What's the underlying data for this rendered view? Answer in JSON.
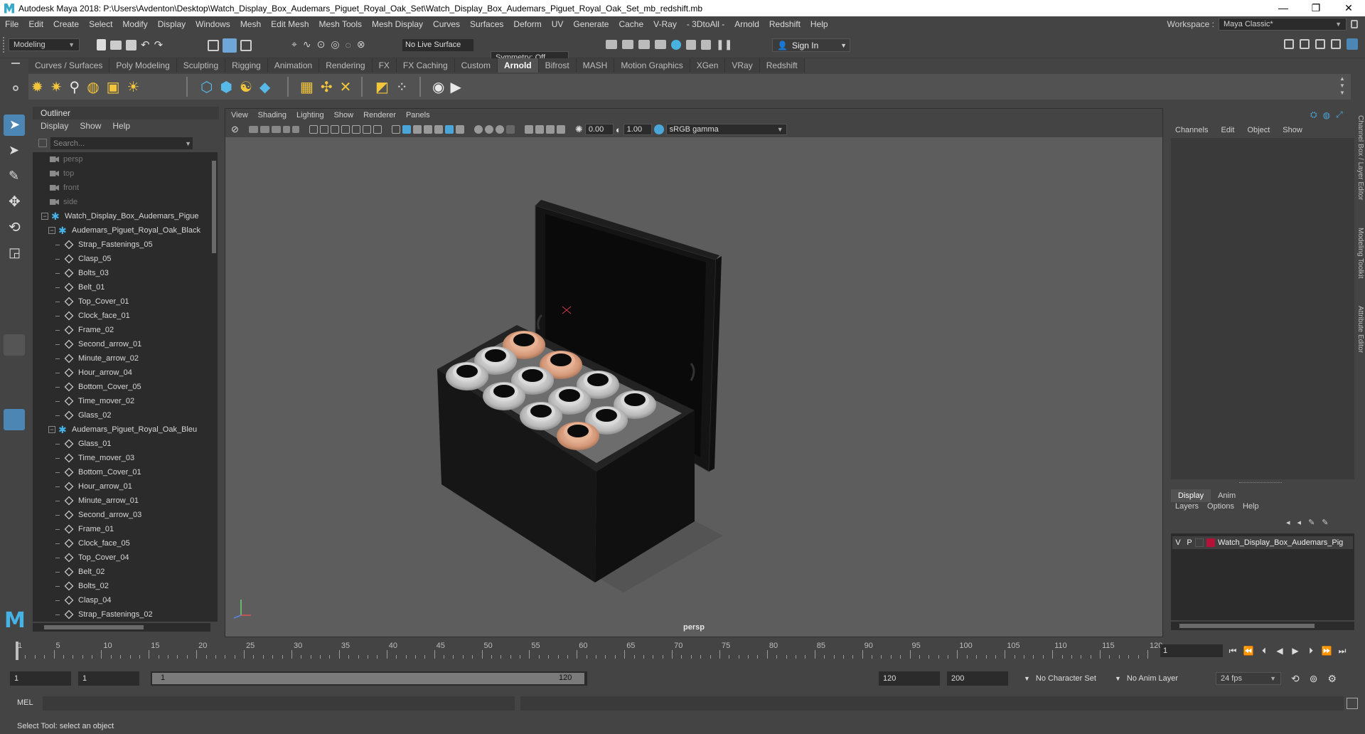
{
  "title_bar": {
    "text": "Autodesk Maya 2018: P:\\Users\\Avdenton\\Desktop\\Watch_Display_Box_Audemars_Piguet_Royal_Oak_Set\\Watch_Display_Box_Audemars_Piguet_Royal_Oak_Set_mb_redshift.mb",
    "minimize": "—",
    "maximize": "❐",
    "close": "✕"
  },
  "menubar": {
    "items": [
      "File",
      "Edit",
      "Create",
      "Select",
      "Modify",
      "Display",
      "Windows",
      "Mesh",
      "Edit Mesh",
      "Mesh Tools",
      "Mesh Display",
      "Curves",
      "Surfaces",
      "Deform",
      "UV",
      "Generate",
      "Cache",
      "V-Ray",
      "- 3DtoAll -",
      "Arnold",
      "Redshift",
      "Help"
    ],
    "workspace_label": "Workspace :",
    "workspace_value": "Maya Classic*"
  },
  "statusline": {
    "mode": "Modeling",
    "live_surface": "No Live Surface",
    "symmetry": "Symmetry: Off",
    "sign_in": "Sign In"
  },
  "shelf": {
    "tabs": [
      "Curves / Surfaces",
      "Poly Modeling",
      "Sculpting",
      "Rigging",
      "Animation",
      "Rendering",
      "FX",
      "FX Caching",
      "Custom",
      "Arnold",
      "Bifrost",
      "MASH",
      "Motion Graphics",
      "XGen",
      "VRay",
      "Redshift"
    ],
    "active_tab": "Arnold"
  },
  "outliner": {
    "title": "Outliner",
    "menu": [
      "Display",
      "Show",
      "Help"
    ],
    "search_placeholder": "Search...",
    "items": [
      {
        "label": "persp",
        "type": "camera",
        "indent": 0
      },
      {
        "label": "top",
        "type": "camera",
        "indent": 0
      },
      {
        "label": "front",
        "type": "camera",
        "indent": 0
      },
      {
        "label": "side",
        "type": "camera",
        "indent": 0
      },
      {
        "label": "Watch_Display_Box_Audemars_Pigue",
        "type": "group",
        "indent": 0,
        "expanded": true
      },
      {
        "label": "Audemars_Piguet_Royal_Oak_Black",
        "type": "group",
        "indent": 1,
        "expanded": true
      },
      {
        "label": "Strap_Fastenings_05",
        "type": "mesh",
        "indent": 2
      },
      {
        "label": "Clasp_05",
        "type": "mesh",
        "indent": 2
      },
      {
        "label": "Bolts_03",
        "type": "mesh",
        "indent": 2
      },
      {
        "label": "Belt_01",
        "type": "mesh",
        "indent": 2
      },
      {
        "label": "Top_Cover_01",
        "type": "mesh",
        "indent": 2
      },
      {
        "label": "Clock_face_01",
        "type": "mesh",
        "indent": 2
      },
      {
        "label": "Frame_02",
        "type": "mesh",
        "indent": 2
      },
      {
        "label": "Second_arrow_01",
        "type": "mesh",
        "indent": 2
      },
      {
        "label": "Minute_arrow_02",
        "type": "mesh",
        "indent": 2
      },
      {
        "label": "Hour_arrow_04",
        "type": "mesh",
        "indent": 2
      },
      {
        "label": "Bottom_Cover_05",
        "type": "mesh",
        "indent": 2
      },
      {
        "label": "Time_mover_02",
        "type": "mesh",
        "indent": 2
      },
      {
        "label": "Glass_02",
        "type": "mesh",
        "indent": 2
      },
      {
        "label": "Audemars_Piguet_Royal_Oak_Bleu",
        "type": "group",
        "indent": 1,
        "expanded": true
      },
      {
        "label": "Glass_01",
        "type": "mesh",
        "indent": 2
      },
      {
        "label": "Time_mover_03",
        "type": "mesh",
        "indent": 2
      },
      {
        "label": "Bottom_Cover_01",
        "type": "mesh",
        "indent": 2
      },
      {
        "label": "Hour_arrow_01",
        "type": "mesh",
        "indent": 2
      },
      {
        "label": "Minute_arrow_01",
        "type": "mesh",
        "indent": 2
      },
      {
        "label": "Second_arrow_03",
        "type": "mesh",
        "indent": 2
      },
      {
        "label": "Frame_01",
        "type": "mesh",
        "indent": 2
      },
      {
        "label": "Clock_face_05",
        "type": "mesh",
        "indent": 2
      },
      {
        "label": "Top_Cover_04",
        "type": "mesh",
        "indent": 2
      },
      {
        "label": "Belt_02",
        "type": "mesh",
        "indent": 2
      },
      {
        "label": "Bolts_02",
        "type": "mesh",
        "indent": 2
      },
      {
        "label": "Clasp_04",
        "type": "mesh",
        "indent": 2
      },
      {
        "label": "Strap_Fastenings_02",
        "type": "mesh",
        "indent": 2
      }
    ]
  },
  "viewport": {
    "menu": [
      "View",
      "Shading",
      "Lighting",
      "Show",
      "Renderer",
      "Panels"
    ],
    "exposure": "0.00",
    "gamma": "1.00",
    "color_space": "sRGB gamma",
    "camera_label": "persp"
  },
  "channel_box": {
    "menu": [
      "Channels",
      "Edit",
      "Object",
      "Show"
    ],
    "layer_tabs": [
      "Display",
      "Anim"
    ],
    "active_layer_tab": "Display",
    "layer_menu": [
      "Layers",
      "Options",
      "Help"
    ],
    "layer": {
      "v": "V",
      "p": "P",
      "name": "Watch_Display_Box_Audemars_Pig",
      "color": "#b5123a"
    },
    "side_tabs": [
      "Channel Box / Layer Editor",
      "Modeling Toolkit",
      "Attribute Editor"
    ]
  },
  "timeslider": {
    "ticks": [
      "1",
      "5",
      "10",
      "15",
      "20",
      "25",
      "30",
      "35",
      "40",
      "45",
      "50",
      "55",
      "60",
      "65",
      "70",
      "75",
      "80",
      "85",
      "90",
      "95",
      "100",
      "105",
      "110",
      "115",
      "120"
    ],
    "current_frame": "1"
  },
  "range": {
    "start": "1",
    "playback_start": "1",
    "slider_start": "1",
    "slider_end": "120",
    "playback_end": "120",
    "end": "200",
    "character_set": "No Character Set",
    "anim_layer": "No Anim Layer",
    "fps": "24 fps"
  },
  "command_line": {
    "label": "MEL"
  },
  "help_line": {
    "text": "Select Tool: select an object"
  }
}
